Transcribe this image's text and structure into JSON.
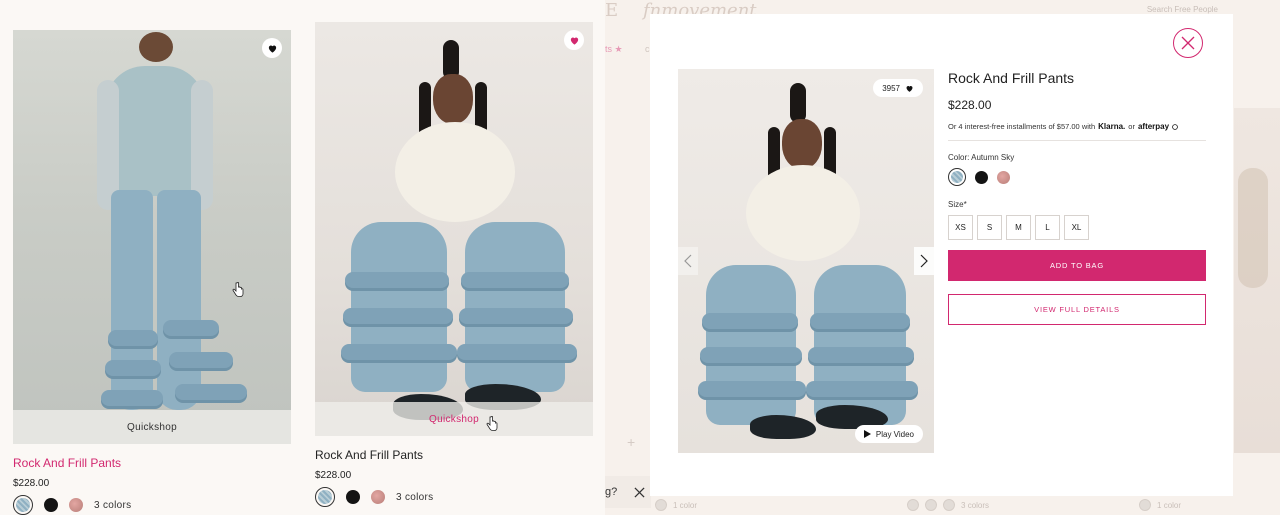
{
  "grid": {
    "cards": [
      {
        "name": "Rock And Frill Pants",
        "price": "$228.00",
        "quickshop": "Quickshop",
        "colors_count": "3 colors",
        "swatches": [
          "autumn-sky",
          "black",
          "rose"
        ]
      },
      {
        "name": "Rock And Frill Pants",
        "price": "$228.00",
        "quickshop": "Quickshop",
        "colors_count": "3 colors",
        "swatches": [
          "autumn-sky",
          "black",
          "rose"
        ]
      }
    ]
  },
  "background": {
    "logo_letter": "E",
    "logo": "fnmovement",
    "search_placeholder": "Search Free People",
    "promo_fragment": "ts ★",
    "nav_fragment": "c",
    "help_fragment": "g?",
    "bottom_counts": [
      "1 color",
      "3 colors",
      "1 color"
    ]
  },
  "modal": {
    "title": "Rock And Frill Pants",
    "price": "$228.00",
    "installments_prefix": "Or 4 interest-free installments of $57.00 with",
    "klarna": "Klarna.",
    "or": "or",
    "afterpay": "afterpay",
    "likes": "3957",
    "play_video": "Play Video",
    "color_label": "Color: Autumn Sky",
    "size_label": "Size*",
    "sizes": [
      "XS",
      "S",
      "M",
      "L",
      "XL"
    ],
    "add_to_bag": "ADD TO BAG",
    "view_details": "VIEW FULL DETAILS"
  },
  "colors": {
    "accent": "#d2286f",
    "text": "#222222",
    "background": "#fbf8f5"
  }
}
